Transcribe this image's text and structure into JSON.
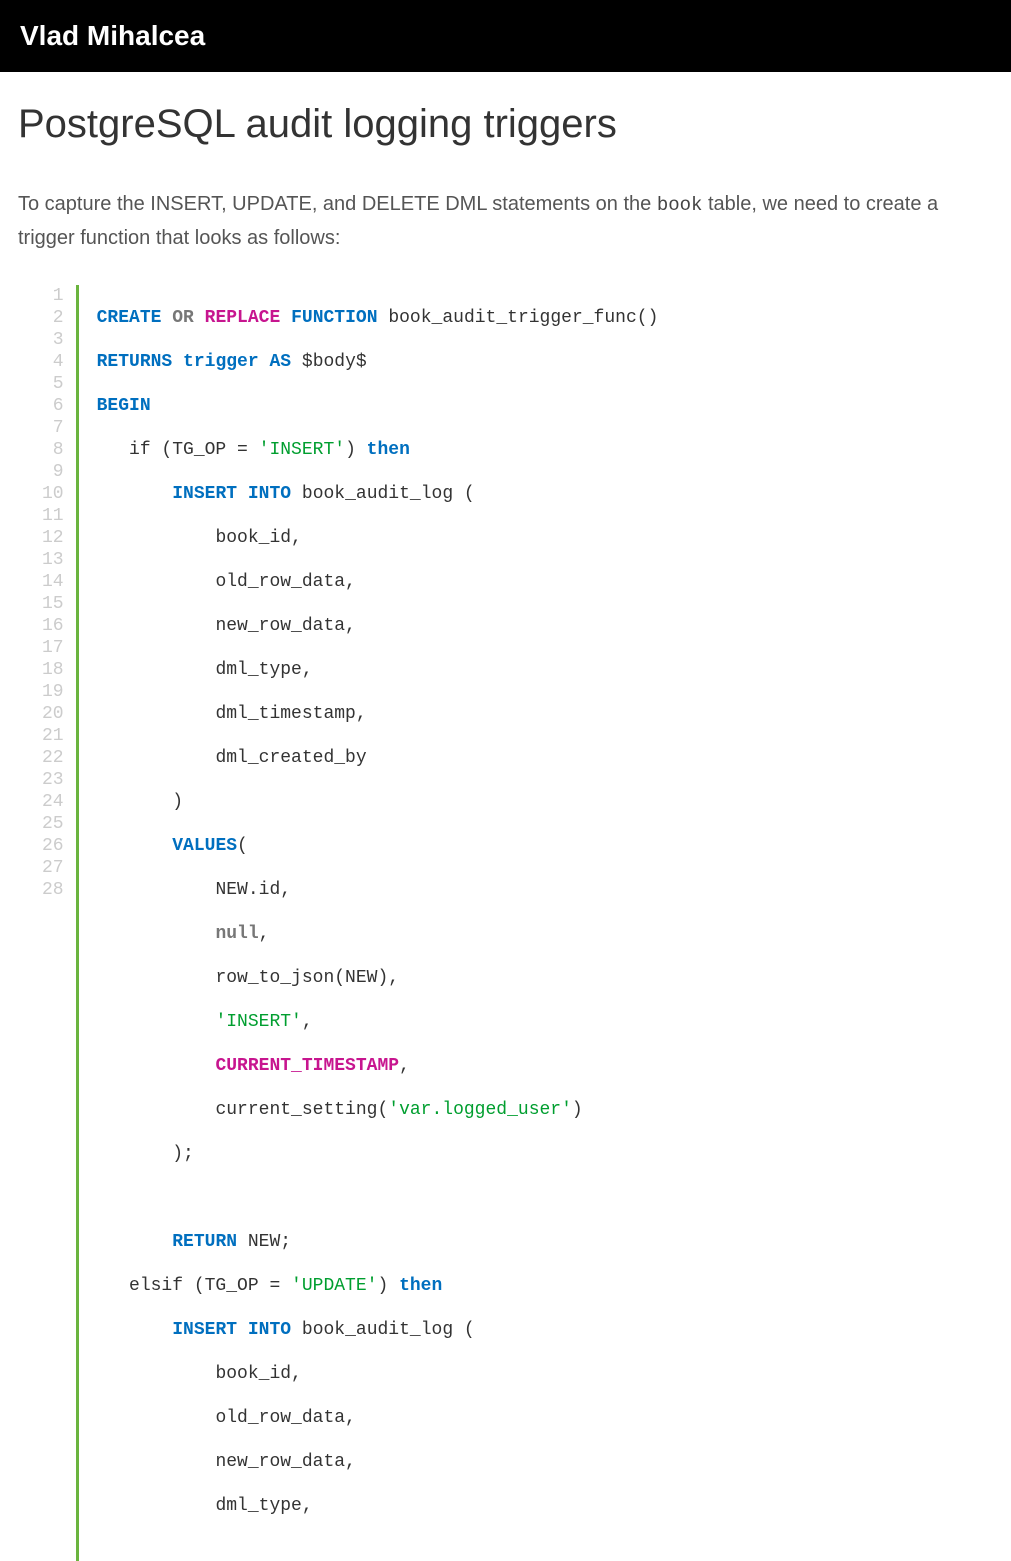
{
  "header": {
    "site_title": "Vlad Mihalcea"
  },
  "article": {
    "title": "PostgreSQL audit logging triggers",
    "intro_pre": "To capture the INSERT, UPDATE, and DELETE DML statements on the ",
    "intro_code": "book",
    "intro_post": " table, we need to create a trigger function that looks as follows:"
  },
  "code": {
    "line_count": 28,
    "tokens": {
      "CREATE": "CREATE",
      "OR": "OR",
      "REPLACE": "REPLACE",
      "FUNCTION": "FUNCTION",
      "func_sig": "book_audit_trigger_func()",
      "RETURNS": "RETURNS",
      "trigger": "trigger",
      "AS": "AS",
      "body_delim": "$body$",
      "BEGIN": "BEGIN",
      "if_open": "   if (TG_OP = ",
      "str_INSERT": "'INSERT'",
      "paren_then": ") ",
      "then": "then",
      "INSERT": "INSERT",
      "INTO": "INTO",
      "table_open": "book_audit_log (",
      "col_book_id": "book_id,",
      "col_old_row": "old_row_data,",
      "col_new_row": "new_row_data,",
      "col_dml_type": "dml_type,",
      "col_dml_ts": "dml_timestamp,",
      "col_dml_by": "dml_created_by",
      "close_paren": ")",
      "VALUES_open": "VALUES",
      "open_paren": "(",
      "NEW_id": "NEW.id,",
      "null_comma": "null",
      "comma": ",",
      "row_to_json_NEW": "row_to_json(NEW),",
      "str_INSERT_comma": "'INSERT'",
      "CURRENT_TIMESTAMP": "CURRENT_TIMESTAMP",
      "cur_setting": "current_setting(",
      "str_var_logged": "'var.logged_user'",
      "close_paren2": ")",
      "stmt_end": ");",
      "RETURN": "RETURN",
      "NEW_semi": "NEW;",
      "elsif_open": "   elsif (TG_OP = ",
      "str_UPDATE": "'UPDATE'"
    }
  }
}
